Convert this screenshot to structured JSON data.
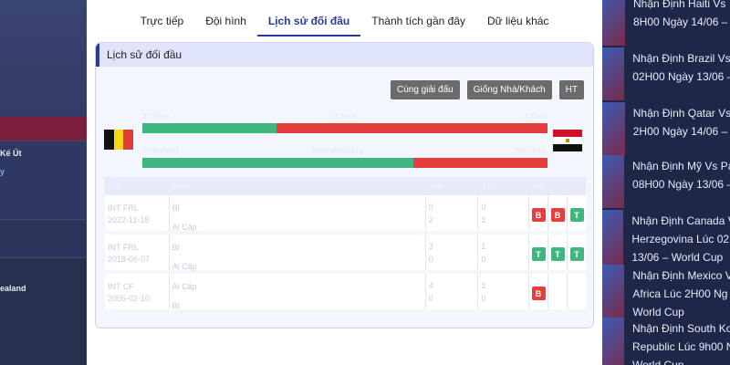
{
  "tabs": [
    {
      "label": "Trực tiếp"
    },
    {
      "label": "Đội hình"
    },
    {
      "label": "Lịch sử đối đầu"
    },
    {
      "label": "Thành tích gần đây"
    },
    {
      "label": "Dữ liệu khác"
    }
  ],
  "card": {
    "title": "Lịch sử đối đầu",
    "filters": [
      "Cùng giải đấu",
      "Giống Nhà/Khách",
      "HT"
    ]
  },
  "bars": [
    {
      "label_left": "3 Thắng",
      "label_mid": "10 Hòa",
      "label_right": "4 Thua",
      "home_share": 0.33
    },
    {
      "label_left": "Tỷ lệ thắng",
      "label_mid": "Tổng bàn thắng",
      "label_right": "Bàn thua",
      "home_share": 0.67
    }
  ],
  "flags": {
    "home": "belgium-flag",
    "away": "egypt-flag"
  },
  "table": {
    "headers": [
      "Giải",
      "Trận",
      "Kèo",
      "T/X",
      "KQ"
    ],
    "rows": [
      {
        "league": "INT FRL",
        "date": "2022-11-18",
        "home": "Bỉ",
        "away": "Ai Cập",
        "score_home": "0",
        "score_away": "2",
        "ht_home": "0",
        "ht_away": "1",
        "results": [
          "B",
          "B",
          "T"
        ]
      },
      {
        "league": "INT FRL",
        "date": "2018-06-07",
        "home": "Bỉ",
        "away": "Ai Cập",
        "score_home": "3",
        "score_away": "0",
        "ht_home": "1",
        "ht_away": "0",
        "results": [
          "T",
          "T",
          "T"
        ]
      },
      {
        "league": "INT CF",
        "date": "2005-02-10",
        "home": "Ai Cập",
        "away": "Bỉ",
        "score_home": "4",
        "score_away": "0",
        "ht_home": "1",
        "ht_away": "0",
        "results": [
          "B",
          "",
          ""
        ]
      }
    ]
  },
  "left_side": {
    "text1": "Kế Út",
    "text2": "y",
    "text3": "ealand"
  },
  "news": [
    {
      "line1": "Nhận Định Haiti Vs",
      "line2": "8H00 Ngày 14/06 –"
    },
    {
      "line1": "Nhận Định Brazil Vs",
      "line2": "02H00 Ngày 13/06 –"
    },
    {
      "line1": "Nhận Định Qatar Vs",
      "line2": "2H00 Ngày 14/06 –"
    },
    {
      "line1": "Nhận Định Mỹ Vs Pa",
      "line2": "08H00 Ngày 13/06 –"
    },
    {
      "line1": "Nhận Định Canada V",
      "line2": "Herzegovina Lúc 02H",
      "line3": "13/06 – World Cup"
    },
    {
      "line1": "Nhận Định Mexico V",
      "line2": "Africa Lúc 2H00 Ng",
      "line3": "World Cup"
    },
    {
      "line1": "Nhận Định South Ko",
      "line2": "Republic Lúc 9h00 N",
      "line3": "World Cup"
    }
  ],
  "colors": {
    "win": "#3fb57f",
    "lose": "#e53e3e",
    "accent": "#2a3a9c"
  }
}
